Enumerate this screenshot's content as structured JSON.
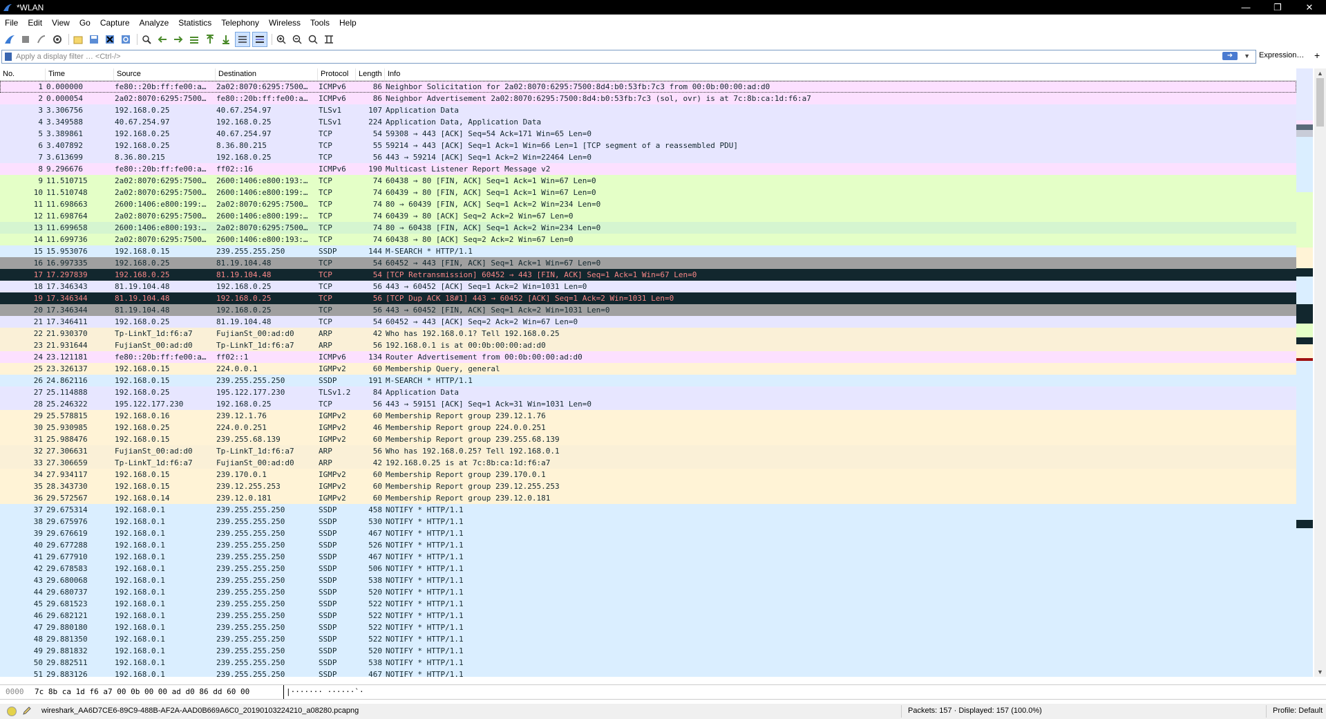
{
  "window": {
    "title": "*WLAN"
  },
  "menu": [
    "File",
    "Edit",
    "View",
    "Go",
    "Capture",
    "Analyze",
    "Statistics",
    "Telephony",
    "Wireless",
    "Tools",
    "Help"
  ],
  "toolbar_icons": [
    "shark-fin-start-icon",
    "stop-icon",
    "restart-icon",
    "capture-options-icon",
    "open-file-icon",
    "save-file-icon",
    "close-file-icon",
    "reload-file-icon",
    "find-packet-icon",
    "go-back-icon",
    "go-forward-icon",
    "go-to-packet-icon",
    "go-first-icon",
    "go-last-icon",
    "autoscroll-icon",
    "colorize-icon",
    "zoom-in-icon",
    "zoom-out-icon",
    "zoom-normal-icon",
    "resize-columns-icon"
  ],
  "filter": {
    "placeholder": "Apply a display filter … <Ctrl-/>",
    "expression_label": "Expression…",
    "add_label": "+"
  },
  "columns": [
    "No.",
    "Time",
    "Source",
    "Destination",
    "Protocol",
    "Length",
    "Info"
  ],
  "packets": [
    {
      "no": "1",
      "time": "0.000000",
      "src": "fe80::20b:ff:fe00:a…",
      "dst": "2a02:8070:6295:7500…",
      "proto": "ICMPv6",
      "len": "86",
      "info": "Neighbor Solicitation for 2a02:8070:6295:7500:8d4:b0:53fb:7c3 from 00:0b:00:00:ad:d0",
      "bg": "#fce0ff",
      "fg": "#12272e"
    },
    {
      "no": "2",
      "time": "0.000054",
      "src": "2a02:8070:6295:7500…",
      "dst": "fe80::20b:ff:fe00:a…",
      "proto": "ICMPv6",
      "len": "86",
      "info": "Neighbor Advertisement 2a02:8070:6295:7500:8d4:b0:53fb:7c3 (sol, ovr) is at 7c:8b:ca:1d:f6:a7",
      "bg": "#fce0ff",
      "fg": "#12272e"
    },
    {
      "no": "3",
      "time": "3.306756",
      "src": "192.168.0.25",
      "dst": "40.67.254.97",
      "proto": "TLSv1",
      "len": "107",
      "info": "Application Data",
      "bg": "#e7e6ff",
      "fg": "#12272e"
    },
    {
      "no": "4",
      "time": "3.349588",
      "src": "40.67.254.97",
      "dst": "192.168.0.25",
      "proto": "TLSv1",
      "len": "224",
      "info": "Application Data, Application Data",
      "bg": "#e7e6ff",
      "fg": "#12272e"
    },
    {
      "no": "5",
      "time": "3.389861",
      "src": "192.168.0.25",
      "dst": "40.67.254.97",
      "proto": "TCP",
      "len": "54",
      "info": "59308 → 443 [ACK] Seq=54 Ack=171 Win=65 Len=0",
      "bg": "#e7e6ff",
      "fg": "#12272e"
    },
    {
      "no": "6",
      "time": "3.407892",
      "src": "192.168.0.25",
      "dst": "8.36.80.215",
      "proto": "TCP",
      "len": "55",
      "info": "59214 → 443 [ACK] Seq=1 Ack=1 Win=66 Len=1 [TCP segment of a reassembled PDU]",
      "bg": "#e7e6ff",
      "fg": "#12272e"
    },
    {
      "no": "7",
      "time": "3.613699",
      "src": "8.36.80.215",
      "dst": "192.168.0.25",
      "proto": "TCP",
      "len": "56",
      "info": "443 → 59214 [ACK] Seq=1 Ack=2 Win=22464 Len=0",
      "bg": "#e7e6ff",
      "fg": "#12272e"
    },
    {
      "no": "8",
      "time": "9.296676",
      "src": "fe80::20b:ff:fe00:a…",
      "dst": "ff02::16",
      "proto": "ICMPv6",
      "len": "190",
      "info": "Multicast Listener Report Message v2",
      "bg": "#fce0ff",
      "fg": "#12272e"
    },
    {
      "no": "9",
      "time": "11.510715",
      "src": "2a02:8070:6295:7500…",
      "dst": "2600:1406:e800:193:…",
      "proto": "TCP",
      "len": "74",
      "info": "60438 → 80 [FIN, ACK] Seq=1 Ack=1 Win=67 Len=0",
      "bg": "#e4ffc7",
      "fg": "#12272e"
    },
    {
      "no": "10",
      "time": "11.510748",
      "src": "2a02:8070:6295:7500…",
      "dst": "2600:1406:e800:199:…",
      "proto": "TCP",
      "len": "74",
      "info": "60439 → 80 [FIN, ACK] Seq=1 Ack=1 Win=67 Len=0",
      "bg": "#e4ffc7",
      "fg": "#12272e"
    },
    {
      "no": "11",
      "time": "11.698663",
      "src": "2600:1406:e800:199:…",
      "dst": "2a02:8070:6295:7500…",
      "proto": "TCP",
      "len": "74",
      "info": "80 → 60439 [FIN, ACK] Seq=1 Ack=2 Win=234 Len=0",
      "bg": "#e4ffc7",
      "fg": "#12272e"
    },
    {
      "no": "12",
      "time": "11.698764",
      "src": "2a02:8070:6295:7500…",
      "dst": "2600:1406:e800:199:…",
      "proto": "TCP",
      "len": "74",
      "info": "60439 → 80 [ACK] Seq=2 Ack=2 Win=67 Len=0",
      "bg": "#e4ffc7",
      "fg": "#12272e"
    },
    {
      "no": "13",
      "time": "11.699658",
      "src": "2600:1406:e800:193:…",
      "dst": "2a02:8070:6295:7500…",
      "proto": "TCP",
      "len": "74",
      "info": "80 → 60438 [FIN, ACK] Seq=1 Ack=2 Win=234 Len=0",
      "bg": "#d5f5d0",
      "fg": "#12272e"
    },
    {
      "no": "14",
      "time": "11.699736",
      "src": "2a02:8070:6295:7500…",
      "dst": "2600:1406:e800:193:…",
      "proto": "TCP",
      "len": "74",
      "info": "60438 → 80 [ACK] Seq=2 Ack=2 Win=67 Len=0",
      "bg": "#e4ffc7",
      "fg": "#12272e"
    },
    {
      "no": "15",
      "time": "15.953076",
      "src": "192.168.0.15",
      "dst": "239.255.255.250",
      "proto": "SSDP",
      "len": "144",
      "info": "M-SEARCH * HTTP/1.1",
      "bg": "#daeeff",
      "fg": "#12272e"
    },
    {
      "no": "16",
      "time": "16.997335",
      "src": "192.168.0.25",
      "dst": "81.19.104.48",
      "proto": "TCP",
      "len": "54",
      "info": "60452 → 443 [FIN, ACK] Seq=1 Ack=1 Win=67 Len=0",
      "bg": "#a0a0a0",
      "fg": "#12272e"
    },
    {
      "no": "17",
      "time": "17.297839",
      "src": "192.168.0.25",
      "dst": "81.19.104.48",
      "proto": "TCP",
      "len": "54",
      "info": "[TCP Retransmission] 60452 → 443 [FIN, ACK] Seq=1 Ack=1 Win=67 Len=0",
      "bg": "#12272e",
      "fg": "#f78787"
    },
    {
      "no": "18",
      "time": "17.346343",
      "src": "81.19.104.48",
      "dst": "192.168.0.25",
      "proto": "TCP",
      "len": "56",
      "info": "443 → 60452 [ACK] Seq=1 Ack=2 Win=1031 Len=0",
      "bg": "#e7e6ff",
      "fg": "#12272e"
    },
    {
      "no": "19",
      "time": "17.346344",
      "src": "81.19.104.48",
      "dst": "192.168.0.25",
      "proto": "TCP",
      "len": "56",
      "info": "[TCP Dup ACK 18#1] 443 → 60452 [ACK] Seq=1 Ack=2 Win=1031 Len=0",
      "bg": "#12272e",
      "fg": "#f78787"
    },
    {
      "no": "20",
      "time": "17.346344",
      "src": "81.19.104.48",
      "dst": "192.168.0.25",
      "proto": "TCP",
      "len": "56",
      "info": "443 → 60452 [FIN, ACK] Seq=1 Ack=2 Win=1031 Len=0",
      "bg": "#a0a0a0",
      "fg": "#12272e"
    },
    {
      "no": "21",
      "time": "17.346411",
      "src": "192.168.0.25",
      "dst": "81.19.104.48",
      "proto": "TCP",
      "len": "54",
      "info": "60452 → 443 [ACK] Seq=2 Ack=2 Win=67 Len=0",
      "bg": "#e7e6ff",
      "fg": "#12272e"
    },
    {
      "no": "22",
      "time": "21.930370",
      "src": "Tp-LinkT_1d:f6:a7",
      "dst": "FujianSt_00:ad:d0",
      "proto": "ARP",
      "len": "42",
      "info": "Who has 192.168.0.1? Tell 192.168.0.25",
      "bg": "#faf0d7",
      "fg": "#12272e"
    },
    {
      "no": "23",
      "time": "21.931644",
      "src": "FujianSt_00:ad:d0",
      "dst": "Tp-LinkT_1d:f6:a7",
      "proto": "ARP",
      "len": "56",
      "info": "192.168.0.1 is at 00:0b:00:00:ad:d0",
      "bg": "#faf0d7",
      "fg": "#12272e"
    },
    {
      "no": "24",
      "time": "23.121181",
      "src": "fe80::20b:ff:fe00:a…",
      "dst": "ff02::1",
      "proto": "ICMPv6",
      "len": "134",
      "info": "Router Advertisement from 00:0b:00:00:ad:d0",
      "bg": "#fce0ff",
      "fg": "#12272e"
    },
    {
      "no": "25",
      "time": "23.326137",
      "src": "192.168.0.15",
      "dst": "224.0.0.1",
      "proto": "IGMPv2",
      "len": "60",
      "info": "Membership Query, general",
      "bg": "#fff3d6",
      "fg": "#12272e"
    },
    {
      "no": "26",
      "time": "24.862116",
      "src": "192.168.0.15",
      "dst": "239.255.255.250",
      "proto": "SSDP",
      "len": "191",
      "info": "M-SEARCH * HTTP/1.1",
      "bg": "#daeeff",
      "fg": "#12272e"
    },
    {
      "no": "27",
      "time": "25.114888",
      "src": "192.168.0.25",
      "dst": "195.122.177.230",
      "proto": "TLSv1.2",
      "len": "84",
      "info": "Application Data",
      "bg": "#e7e6ff",
      "fg": "#12272e"
    },
    {
      "no": "28",
      "time": "25.246322",
      "src": "195.122.177.230",
      "dst": "192.168.0.25",
      "proto": "TCP",
      "len": "56",
      "info": "443 → 59151 [ACK] Seq=1 Ack=31 Win=1031 Len=0",
      "bg": "#e7e6ff",
      "fg": "#12272e"
    },
    {
      "no": "29",
      "time": "25.578815",
      "src": "192.168.0.16",
      "dst": "239.12.1.76",
      "proto": "IGMPv2",
      "len": "60",
      "info": "Membership Report group 239.12.1.76",
      "bg": "#fff3d6",
      "fg": "#12272e"
    },
    {
      "no": "30",
      "time": "25.930985",
      "src": "192.168.0.25",
      "dst": "224.0.0.251",
      "proto": "IGMPv2",
      "len": "46",
      "info": "Membership Report group 224.0.0.251",
      "bg": "#fff3d6",
      "fg": "#12272e"
    },
    {
      "no": "31",
      "time": "25.988476",
      "src": "192.168.0.15",
      "dst": "239.255.68.139",
      "proto": "IGMPv2",
      "len": "60",
      "info": "Membership Report group 239.255.68.139",
      "bg": "#fff3d6",
      "fg": "#12272e"
    },
    {
      "no": "32",
      "time": "27.306631",
      "src": "FujianSt_00:ad:d0",
      "dst": "Tp-LinkT_1d:f6:a7",
      "proto": "ARP",
      "len": "56",
      "info": "Who has 192.168.0.25? Tell 192.168.0.1",
      "bg": "#faf0d7",
      "fg": "#12272e"
    },
    {
      "no": "33",
      "time": "27.306659",
      "src": "Tp-LinkT_1d:f6:a7",
      "dst": "FujianSt_00:ad:d0",
      "proto": "ARP",
      "len": "42",
      "info": "192.168.0.25 is at 7c:8b:ca:1d:f6:a7",
      "bg": "#faf0d7",
      "fg": "#12272e"
    },
    {
      "no": "34",
      "time": "27.934117",
      "src": "192.168.0.15",
      "dst": "239.170.0.1",
      "proto": "IGMPv2",
      "len": "60",
      "info": "Membership Report group 239.170.0.1",
      "bg": "#fff3d6",
      "fg": "#12272e"
    },
    {
      "no": "35",
      "time": "28.343730",
      "src": "192.168.0.15",
      "dst": "239.12.255.253",
      "proto": "IGMPv2",
      "len": "60",
      "info": "Membership Report group 239.12.255.253",
      "bg": "#fff3d6",
      "fg": "#12272e"
    },
    {
      "no": "36",
      "time": "29.572567",
      "src": "192.168.0.14",
      "dst": "239.12.0.181",
      "proto": "IGMPv2",
      "len": "60",
      "info": "Membership Report group 239.12.0.181",
      "bg": "#fff3d6",
      "fg": "#12272e"
    },
    {
      "no": "37",
      "time": "29.675314",
      "src": "192.168.0.1",
      "dst": "239.255.255.250",
      "proto": "SSDP",
      "len": "458",
      "info": "NOTIFY * HTTP/1.1",
      "bg": "#daeeff",
      "fg": "#12272e"
    },
    {
      "no": "38",
      "time": "29.675976",
      "src": "192.168.0.1",
      "dst": "239.255.255.250",
      "proto": "SSDP",
      "len": "530",
      "info": "NOTIFY * HTTP/1.1",
      "bg": "#daeeff",
      "fg": "#12272e"
    },
    {
      "no": "39",
      "time": "29.676619",
      "src": "192.168.0.1",
      "dst": "239.255.255.250",
      "proto": "SSDP",
      "len": "467",
      "info": "NOTIFY * HTTP/1.1",
      "bg": "#daeeff",
      "fg": "#12272e"
    },
    {
      "no": "40",
      "time": "29.677288",
      "src": "192.168.0.1",
      "dst": "239.255.255.250",
      "proto": "SSDP",
      "len": "526",
      "info": "NOTIFY * HTTP/1.1",
      "bg": "#daeeff",
      "fg": "#12272e"
    },
    {
      "no": "41",
      "time": "29.677910",
      "src": "192.168.0.1",
      "dst": "239.255.255.250",
      "proto": "SSDP",
      "len": "467",
      "info": "NOTIFY * HTTP/1.1",
      "bg": "#daeeff",
      "fg": "#12272e"
    },
    {
      "no": "42",
      "time": "29.678583",
      "src": "192.168.0.1",
      "dst": "239.255.255.250",
      "proto": "SSDP",
      "len": "506",
      "info": "NOTIFY * HTTP/1.1",
      "bg": "#daeeff",
      "fg": "#12272e"
    },
    {
      "no": "43",
      "time": "29.680068",
      "src": "192.168.0.1",
      "dst": "239.255.255.250",
      "proto": "SSDP",
      "len": "538",
      "info": "NOTIFY * HTTP/1.1",
      "bg": "#daeeff",
      "fg": "#12272e"
    },
    {
      "no": "44",
      "time": "29.680737",
      "src": "192.168.0.1",
      "dst": "239.255.255.250",
      "proto": "SSDP",
      "len": "520",
      "info": "NOTIFY * HTTP/1.1",
      "bg": "#daeeff",
      "fg": "#12272e"
    },
    {
      "no": "45",
      "time": "29.681523",
      "src": "192.168.0.1",
      "dst": "239.255.255.250",
      "proto": "SSDP",
      "len": "522",
      "info": "NOTIFY * HTTP/1.1",
      "bg": "#daeeff",
      "fg": "#12272e"
    },
    {
      "no": "46",
      "time": "29.682121",
      "src": "192.168.0.1",
      "dst": "239.255.255.250",
      "proto": "SSDP",
      "len": "522",
      "info": "NOTIFY * HTTP/1.1",
      "bg": "#daeeff",
      "fg": "#12272e"
    },
    {
      "no": "47",
      "time": "29.880180",
      "src": "192.168.0.1",
      "dst": "239.255.255.250",
      "proto": "SSDP",
      "len": "522",
      "info": "NOTIFY * HTTP/1.1",
      "bg": "#daeeff",
      "fg": "#12272e"
    },
    {
      "no": "48",
      "time": "29.881350",
      "src": "192.168.0.1",
      "dst": "239.255.255.250",
      "proto": "SSDP",
      "len": "522",
      "info": "NOTIFY * HTTP/1.1",
      "bg": "#daeeff",
      "fg": "#12272e"
    },
    {
      "no": "49",
      "time": "29.881832",
      "src": "192.168.0.1",
      "dst": "239.255.255.250",
      "proto": "SSDP",
      "len": "520",
      "info": "NOTIFY * HTTP/1.1",
      "bg": "#daeeff",
      "fg": "#12272e"
    },
    {
      "no": "50",
      "time": "29.882511",
      "src": "192.168.0.1",
      "dst": "239.255.255.250",
      "proto": "SSDP",
      "len": "538",
      "info": "NOTIFY * HTTP/1.1",
      "bg": "#daeeff",
      "fg": "#12272e"
    },
    {
      "no": "51",
      "time": "29.883126",
      "src": "192.168.0.1",
      "dst": "239.255.255.250",
      "proto": "SSDP",
      "len": "467",
      "info": "NOTIFY * HTTP/1.1",
      "bg": "#daeeff",
      "fg": "#12272e"
    }
  ],
  "selected_packet": "1",
  "hex": {
    "offset": "0000",
    "bytes": "7c 8b ca 1d f6 a7 00 0b  00 00 ad d0 86 dd 60 00",
    "ascii": "|·······  ······`·"
  },
  "status": {
    "file": "wireshark_AA6D7CE6-89C9-488B-AF2A-AAD0B669A6C0_20190103224210_a08280.pcapng",
    "packets": "Packets: 157 · Displayed: 157 (100.0%)",
    "profile": "Profile: Default"
  },
  "colors": {
    "titlebar": "#000000",
    "selection_border": "#7a9bc4",
    "accent": "#3a66b0"
  }
}
